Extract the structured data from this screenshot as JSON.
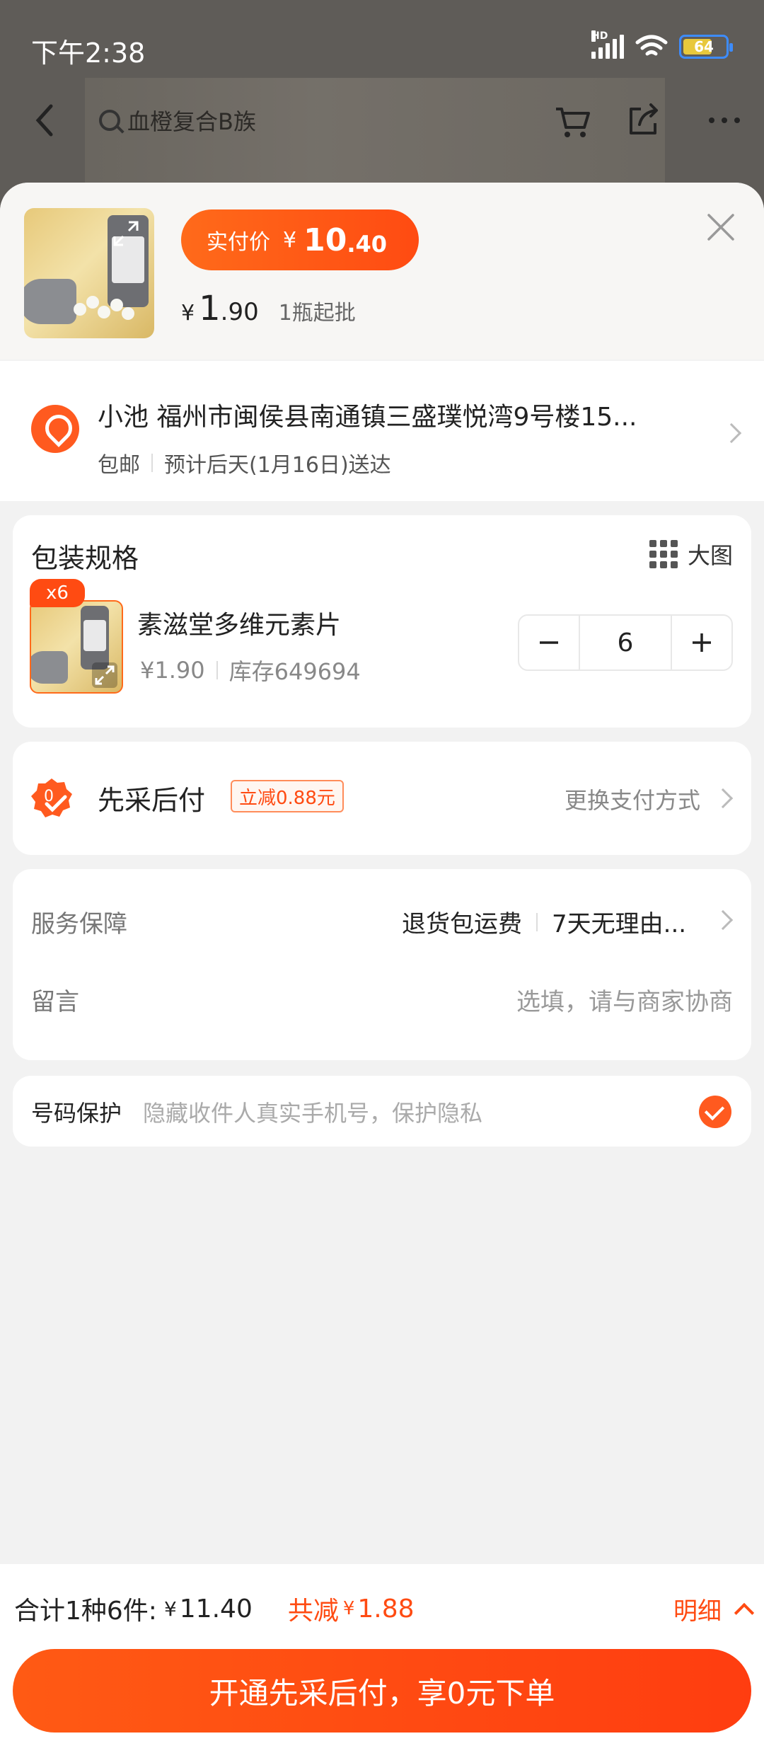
{
  "status_bar": {
    "time": "下午2:38",
    "network": "HD",
    "battery": "64"
  },
  "top_nav": {
    "search_placeholder": "血橙复合B族"
  },
  "header": {
    "price_label": "实付价",
    "price_currency": "¥",
    "price_int": "10",
    "price_dec": ".40",
    "unit_currency": "¥",
    "unit_int": "1",
    "unit_dec": ".90",
    "moq": "1瓶起批"
  },
  "address": {
    "line": "小池  福州市闽侯县南通镇三盛璞悦湾9号楼15...",
    "shipping": "包邮",
    "eta": "预计后天(1月16日)送达"
  },
  "spec": {
    "title": "包装规格",
    "big_image": "大图",
    "qty_badge": "x6",
    "name": "素滋堂多维元素片",
    "price": "¥1.90",
    "stock": "库存649694",
    "quantity": "6"
  },
  "payment": {
    "title": "先采后付",
    "discount_tag": "立减0.88元",
    "change": "更换支付方式"
  },
  "service": {
    "label": "服务保障",
    "item1": "退货包运费",
    "item2": "7天无理由...",
    "message_label": "留言",
    "message_placeholder": "选填，请与商家协商"
  },
  "privacy": {
    "label": "号码保护",
    "desc": "隐藏收件人真实手机号，保护隐私",
    "checked": true
  },
  "footer": {
    "total_label": "合计1种6件:",
    "total_currency": "¥",
    "total_value": "11.40",
    "save_label": "共减",
    "save_currency": "¥",
    "save_value": "1.88",
    "detail": "明细",
    "cta": "开通先采后付，享0元下单"
  },
  "colors": {
    "accent": "#ff4b12",
    "background": "#f2f2f2"
  }
}
